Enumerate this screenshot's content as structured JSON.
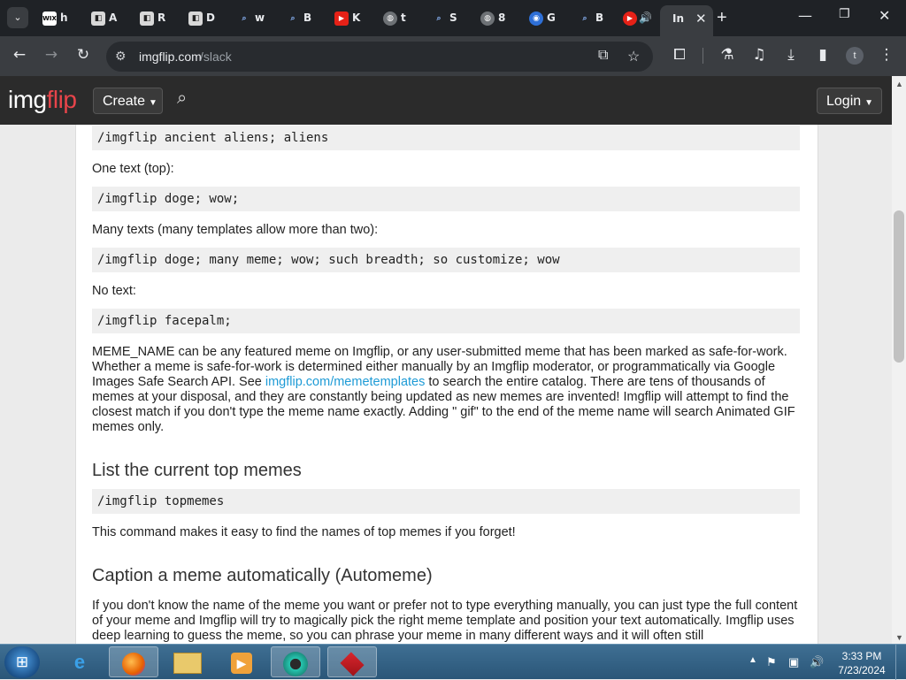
{
  "browser": {
    "tabs": [
      {
        "label": "h",
        "icon": "wix-icon"
      },
      {
        "label": "A",
        "icon": "page-icon"
      },
      {
        "label": "R",
        "icon": "page-icon"
      },
      {
        "label": "D",
        "icon": "page-icon"
      },
      {
        "label": "w",
        "icon": "search-icon"
      },
      {
        "label": "B",
        "icon": "search-icon"
      },
      {
        "label": "K",
        "icon": "youtube-icon"
      },
      {
        "label": "t",
        "icon": "globe-icon"
      },
      {
        "label": "S",
        "icon": "search-icon"
      },
      {
        "label": "8",
        "icon": "globe-icon"
      },
      {
        "label": "G",
        "icon": "lens-icon"
      },
      {
        "label": "B",
        "icon": "search-icon"
      },
      {
        "label": "",
        "icon": "youtube-audio-icon"
      }
    ],
    "active_tab": {
      "label": "In",
      "icon": "imgflip-icon"
    },
    "url_host": "imgflip.com",
    "url_path": "/slack"
  },
  "site": {
    "logo_primary": "img",
    "logo_secondary": "flip",
    "create_label": "Create",
    "login_label": "Login"
  },
  "content": {
    "code_aliens": "/imgflip ancient aliens; aliens",
    "label_one_text": "One text (top):",
    "code_doge": "/imgflip doge; wow;",
    "label_many_texts": "Many texts (many templates allow more than two):",
    "code_many": "/imgflip doge; many meme; wow; such breadth; so customize; wow",
    "label_no_text": "No text:",
    "code_facepalm": "/imgflip facepalm;",
    "para_meme_name_1": "MEME_NAME can be any featured meme on Imgflip, or any user-submitted meme that has been marked as safe-for-work. Whether a meme is safe-for-work is determined either manually by an Imgflip moderator, or programmatically via Google Images Safe Search API. See ",
    "link_memetemplates": "imgflip.com/memetemplates",
    "para_meme_name_2": " to search the entire catalog. There are tens of thousands of memes at your disposal, and they are constantly being updated as new memes are invented! Imgflip will attempt to find the closest match if you don't type the meme name exactly. Adding \" gif\" to the end of the meme name will search Animated GIF memes only.",
    "heading_top_memes": "List the current top memes",
    "code_topmemes": "/imgflip topmemes",
    "para_topmemes": "This command makes it easy to find the names of top memes if you forget!",
    "heading_automeme": "Caption a meme automatically (Automeme)",
    "para_automeme": "If you don't know the name of the meme you want or prefer not to type everything manually, you can just type the full content of your meme and Imgflip will try to magically pick the right meme template and position your text automatically. Imgflip uses deep learning to guess the meme, so you can phrase your meme in many different ways and it will often still"
  },
  "taskbar": {
    "clock_time": "3:33 PM",
    "clock_date": "7/23/2024",
    "apps": [
      "internet-explorer-icon",
      "firefox-icon",
      "file-explorer-icon",
      "media-player-icon",
      "chrome-like-icon",
      "app-red-icon"
    ]
  },
  "colors": {
    "brand_red": "#e8444a",
    "link_blue": "#1e9bd6",
    "header_bg": "#2b2b2b"
  }
}
